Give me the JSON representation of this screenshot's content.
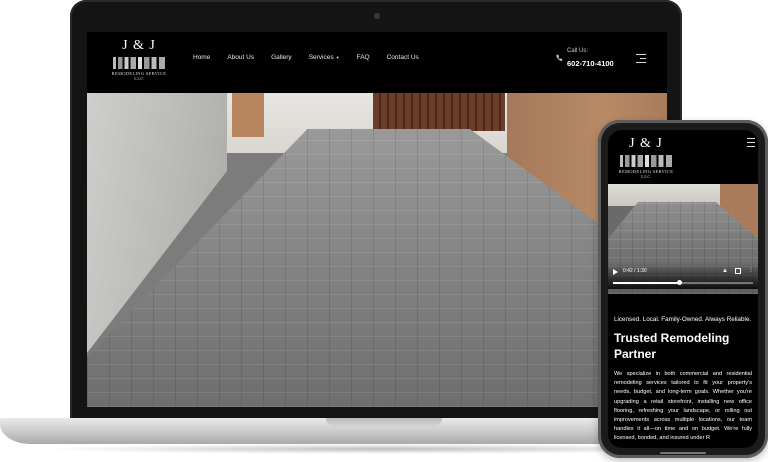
{
  "site": {
    "logo": {
      "mark": "J & J",
      "subtitle": "REMODELING SERVICE LLC"
    },
    "nav": [
      {
        "label": "Home"
      },
      {
        "label": "About Us"
      },
      {
        "label": "Gallery"
      },
      {
        "label": "Services"
      },
      {
        "label": "FAQ"
      },
      {
        "label": "Contact Us"
      }
    ],
    "call_label": "Call Us:",
    "call_number": "602-710-4100"
  },
  "phone": {
    "video": {
      "time": "0:42 / 1:30",
      "progress": 0.47
    },
    "tagline": "Licensed. Local. Family-Owned. Always Reliable.",
    "heading": "Trusted Remodeling Partner",
    "body": "We specialize in both commercial and residential remodeling services tailored to fit your property's needs, budget, and long-term goals. Whether you're upgrading a retail storefront, installing new office flooring, refreshing your landscape, or rolling out improvements across multiple locations, our team handles it all—on time and on budget. We're fully licensed, bonded, and insured under R"
  },
  "colors": {
    "header_bg": "#000000",
    "text": "#ffffff"
  }
}
